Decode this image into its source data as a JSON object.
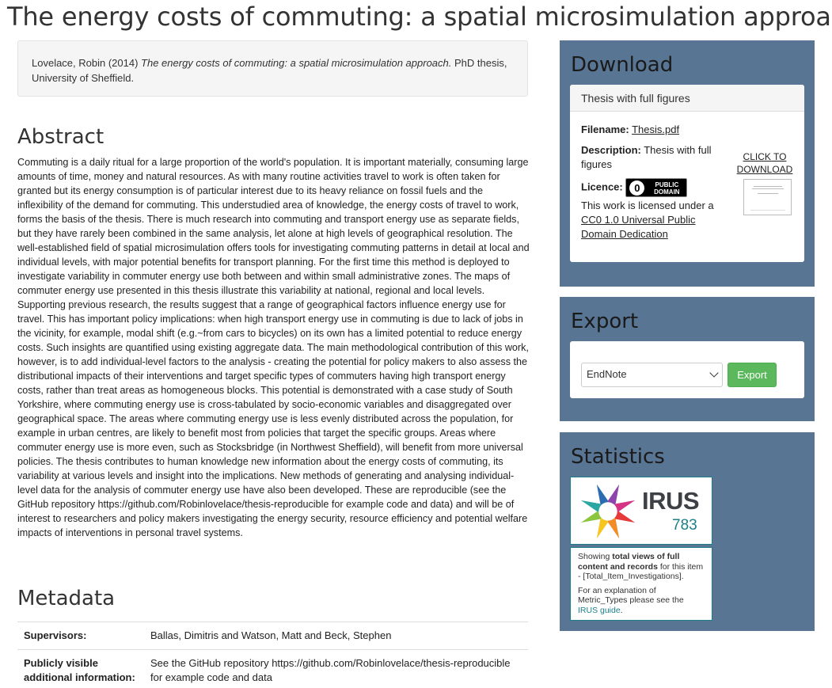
{
  "title": "The energy costs of commuting: a spatial microsimulation approach",
  "citation": {
    "prefix": "Lovelace, Robin (2014) ",
    "title": "The energy costs of commuting: a spatial microsimulation approach.",
    "suffix": " PhD thesis, University of Sheffield."
  },
  "abstract": {
    "heading": "Abstract",
    "text": "Commuting is a daily ritual for a large proportion of the world's population. It is important materially, consuming large amounts of time, money and natural resources. As with many routine activities travel to work is often taken for granted but its energy consumption is of particular interest due to its heavy reliance on fossil fuels and the inflexibility of the demand for commuting. This understudied area of knowledge, the energy costs of travel to work, forms the basis of the thesis. There is much research into commuting and transport energy use as separate fields, but they have rarely been combined in the same analysis, let alone at high levels of geographical resolution. The well-established field of spatial microsimulation offers tools for investigating commuting patterns in detail at local and individual levels, with major potential benefits for transport planning. For the first time this method is deployed to investigate variability in commuter energy use both between and within small administrative zones. The maps of commuter energy use presented in this thesis illustrate this variability at national, regional and local levels. Supporting previous research, the results suggest that a range of geographical factors influence energy use for travel. This has important policy implications: when high transport energy use in commuting is due to lack of jobs in the vicinity, for example, modal shift (e.g.~from cars to bicycles) on its own has a limited potential to reduce energy costs. Such insights are quantified using existing aggregate data. The main methodological contribution of this work, however, is to add individual-level factors to the analysis - creating the potential for policy makers to also assess the distributional impacts of their interventions and target specific types of commuters having high transport energy costs, rather than treat areas as homogeneous blocks. This potential is demonstrated with a case study of South Yorkshire, where commuting energy use is cross-tabulated by socio-economic variables and disaggregated over geographical space. The areas where commuting energy use is less evenly distributed across the population, for example in urban centres, are likely to benefit most from policies that target the specific groups. Areas where commuter energy use is more even, such as Stocksbridge (in Northwest Sheffield), will benefit from more universal policies. The thesis contributes to human knowledge new information about the energy costs of commuting, its variability at various levels and insight into the implications. New methods of generating and analysing individual-level data for the analysis of commuter energy use have also been developed. These are reproducible (see the GitHub repository https://github.com/Robinlovelace/thesis-reproducible for example code and data) and will be of interest to researchers and policy makers investigating the energy security, resource efficiency and potential welfare impacts of interventions in personal travel systems."
  },
  "metadata": {
    "heading": "Metadata",
    "rows": [
      {
        "key": "Supervisors:",
        "value": "Ballas, Dimitris and Watson, Matt and Beck, Stephen"
      },
      {
        "key": "Publicly visible additional information:",
        "value": "See the GitHub repository https://github.com/Robinlovelace/thesis-reproducible for example code and data"
      }
    ]
  },
  "download": {
    "heading": "Download",
    "card_title": "Thesis with full figures",
    "filename_label": "Filename:",
    "filename": "Thesis.pdf",
    "description_label": "Description:",
    "description": "Thesis with full figures",
    "licence_label": "Licence:",
    "badge_symbol": "0",
    "badge_text": "PUBLIC DOMAIN",
    "license_text": "This work is licensed under a ",
    "license_link": "CC0 1.0 Universal Public Domain Dedication",
    "click_to_download": "CLICK TO DOWNLOAD"
  },
  "export": {
    "heading": "Export",
    "selected": "EndNote",
    "button": "Export"
  },
  "statistics": {
    "heading": "Statistics",
    "irus_name": "IRUS",
    "count": "783",
    "info_prefix": "Showing ",
    "info_bold": "total views of full content and records",
    "info_suffix": " for this item - [Total_Item_Investigations].",
    "explain_text": "For an explanation of Metric_Types please see the ",
    "guide_link": "IRUS guide",
    "guide_suffix": ".",
    "logo_colors": [
      "#e63a3a",
      "#f28c28",
      "#f7c51e",
      "#8cc63f",
      "#2aa7a0",
      "#2b6cb0",
      "#8e44ad",
      "#d63384"
    ]
  }
}
